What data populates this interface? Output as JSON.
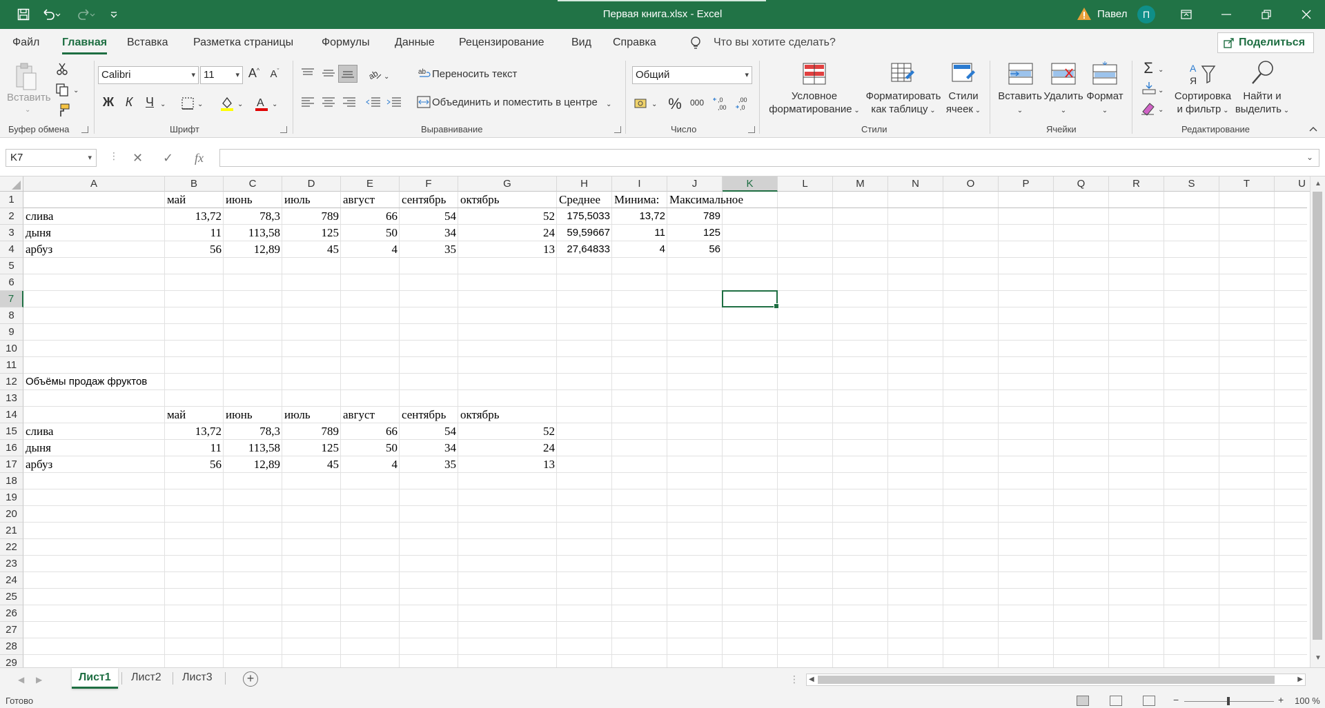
{
  "window": {
    "title": "Первая книга.xlsx  -  Excel",
    "user": "Павел",
    "avatar_initial": "П",
    "colors": {
      "accent": "#217346",
      "accent_dark": "#1e6e42",
      "warning": "#e8a13a"
    }
  },
  "menu": {
    "tabs": [
      "Файл",
      "Главная",
      "Вставка",
      "Разметка страницы",
      "Формулы",
      "Данные",
      "Рецензирование",
      "Вид",
      "Справка"
    ],
    "active": "Главная",
    "tell_me": "Что вы хотите сделать?",
    "share": "Поделиться"
  },
  "ribbon": {
    "clipboard": {
      "paste": "Вставить",
      "label": "Буфер обмена"
    },
    "font": {
      "name": "Calibri",
      "size": "11",
      "bold": "Ж",
      "italic": "К",
      "underline": "Ч",
      "label": "Шрифт"
    },
    "alignment": {
      "wrap": "Переносить текст",
      "merge": "Объединить и поместить в центре",
      "label": "Выравнивание"
    },
    "number": {
      "format": "Общий",
      "label": "Число"
    },
    "styles": {
      "conditional_1": "Условное",
      "conditional_2": "форматирование",
      "table_1": "Форматировать",
      "table_2": "как таблицу",
      "cell_1": "Стили",
      "cell_2": "ячеек",
      "label": "Стили"
    },
    "cells": {
      "insert": "Вставить",
      "delete": "Удалить",
      "format": "Формат",
      "label": "Ячейки"
    },
    "editing": {
      "sort_1": "Сортировка",
      "sort_2": "и фильтр",
      "find_1": "Найти и",
      "find_2": "выделить",
      "label": "Редактирование"
    }
  },
  "formula_bar": {
    "name_box": "K7",
    "formula": ""
  },
  "grid": {
    "columns": [
      "A",
      "B",
      "C",
      "D",
      "E",
      "F",
      "G",
      "H",
      "I",
      "J",
      "K",
      "L",
      "M",
      "N",
      "O",
      "P",
      "Q",
      "R",
      "S",
      "T",
      "U"
    ],
    "selected_column": "K",
    "rows": [
      "1",
      "2",
      "3",
      "4",
      "5",
      "6",
      "7",
      "8",
      "9",
      "10",
      "11",
      "12",
      "13",
      "14",
      "15",
      "16",
      "17",
      "18",
      "19",
      "20",
      "21",
      "22",
      "23",
      "24",
      "25",
      "26",
      "27",
      "28",
      "29"
    ],
    "selected_row": "7",
    "cells": {
      "B1": "май",
      "C1": "июнь",
      "D1": "июль",
      "E1": "август",
      "F1": "сентябрь",
      "G1": "октябрь",
      "H1": "Среднее",
      "I1": "Минима:",
      "J1": "Максимальное",
      "A2": "слива",
      "B2": "13,72",
      "C2": "78,3",
      "D2": "789",
      "E2": "66",
      "F2": "54",
      "G2": "52",
      "H2": "175,5033",
      "I2": "13,72",
      "J2": "789",
      "A3": "дыня",
      "B3": "11",
      "C3": "113,58",
      "D3": "125",
      "E3": "50",
      "F3": "34",
      "G3": "24",
      "H3": "59,59667",
      "I3": "11",
      "J3": "125",
      "A4": "арбуз",
      "B4": "56",
      "C4": "12,89",
      "D4": "45",
      "E4": "4",
      "F4": "35",
      "G4": "13",
      "H4": "27,64833",
      "I4": "4",
      "J4": "56",
      "A12": "Объёмы продаж фруктов",
      "B14": "май",
      "C14": "июнь",
      "D14": "июль",
      "E14": "август",
      "F14": "сентябрь",
      "G14": "октябрь",
      "A15": "слива",
      "B15": "13,72",
      "C15": "78,3",
      "D15": "789",
      "E15": "66",
      "F15": "54",
      "G15": "52",
      "A16": "дыня",
      "B16": "11",
      "C16": "113,58",
      "D16": "125",
      "E16": "50",
      "F16": "34",
      "G16": "24",
      "A17": "арбуз",
      "B17": "56",
      "C17": "12,89",
      "D17": "45",
      "E17": "4",
      "F17": "35",
      "G17": "13"
    }
  },
  "sheets": {
    "tabs": [
      "Лист1",
      "Лист2",
      "Лист3"
    ],
    "active": "Лист1"
  },
  "status": {
    "ready": "Готово",
    "zoom": "100 %"
  }
}
